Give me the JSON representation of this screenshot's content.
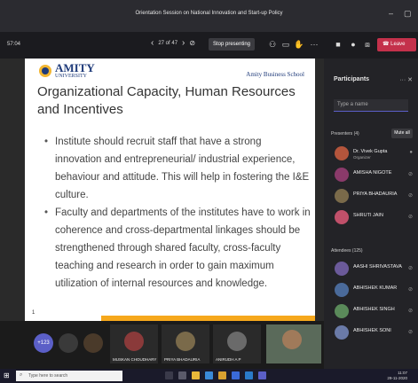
{
  "window": {
    "title": "Orientation Session on National Innovation and Start-up Policy"
  },
  "meeting": {
    "timer": "57:04",
    "page": "27 of 47",
    "stop_label": "Stop presenting",
    "leave_label": "Leave"
  },
  "slide": {
    "logo_name": "AMITY",
    "logo_sub": "UNIVERSITY",
    "school": "Amity Business School",
    "title": "Organizational Capacity, Human Resources and Incentives",
    "bullets": [
      "Institute should recruit staff that have a strong innovation and entrepreneurial/ industrial experience, behaviour and attitude. This will help in fostering the I&E culture.",
      "Faculty and departments of the institutes have to work in coherence and cross-departmental linkages should be strengthened through shared faculty, cross-faculty teaching and research in order to gain maximum utilization of internal resources and knowledge."
    ],
    "page_number": "1"
  },
  "participants": {
    "title": "Participants",
    "search_placeholder": "Type a name",
    "presenters_label": "Presenters (4)",
    "mute_all": "Mute all",
    "presenters": [
      {
        "name": "Dr. Vivek Gupta",
        "role": "Organizer",
        "color": "#b4553c"
      },
      {
        "name": "AMISHA NIGOTE",
        "role": "",
        "color": "#8a3a6a"
      },
      {
        "name": "PRIYA BHADAURIA",
        "role": "",
        "color": "#7a6a4a"
      },
      {
        "name": "SHRUTI JAIN",
        "role": "",
        "color": "#c0506a"
      }
    ],
    "attendees_label": "Attendees (125)",
    "attendees": [
      {
        "name": "AASHI SHRIVASTAVA",
        "color": "#6b5a9a"
      },
      {
        "name": "ABHISHEK KUMAR",
        "color": "#4a6a9a"
      },
      {
        "name": "ABHISHEK SINGH",
        "color": "#5a8a5a"
      },
      {
        "name": "ABHISHEK SONI",
        "color": "#6a7aa8"
      }
    ]
  },
  "gallery": {
    "more_count": "+123",
    "tiles": [
      {
        "name": "MUSKAN CHOUDHARY"
      },
      {
        "name": "PRIYA BHADAURIA"
      },
      {
        "name": "ANIRUDH A P"
      }
    ]
  },
  "taskbar": {
    "search_placeholder": "Type here to search",
    "time": "11:07",
    "date": "29-11-2020"
  }
}
